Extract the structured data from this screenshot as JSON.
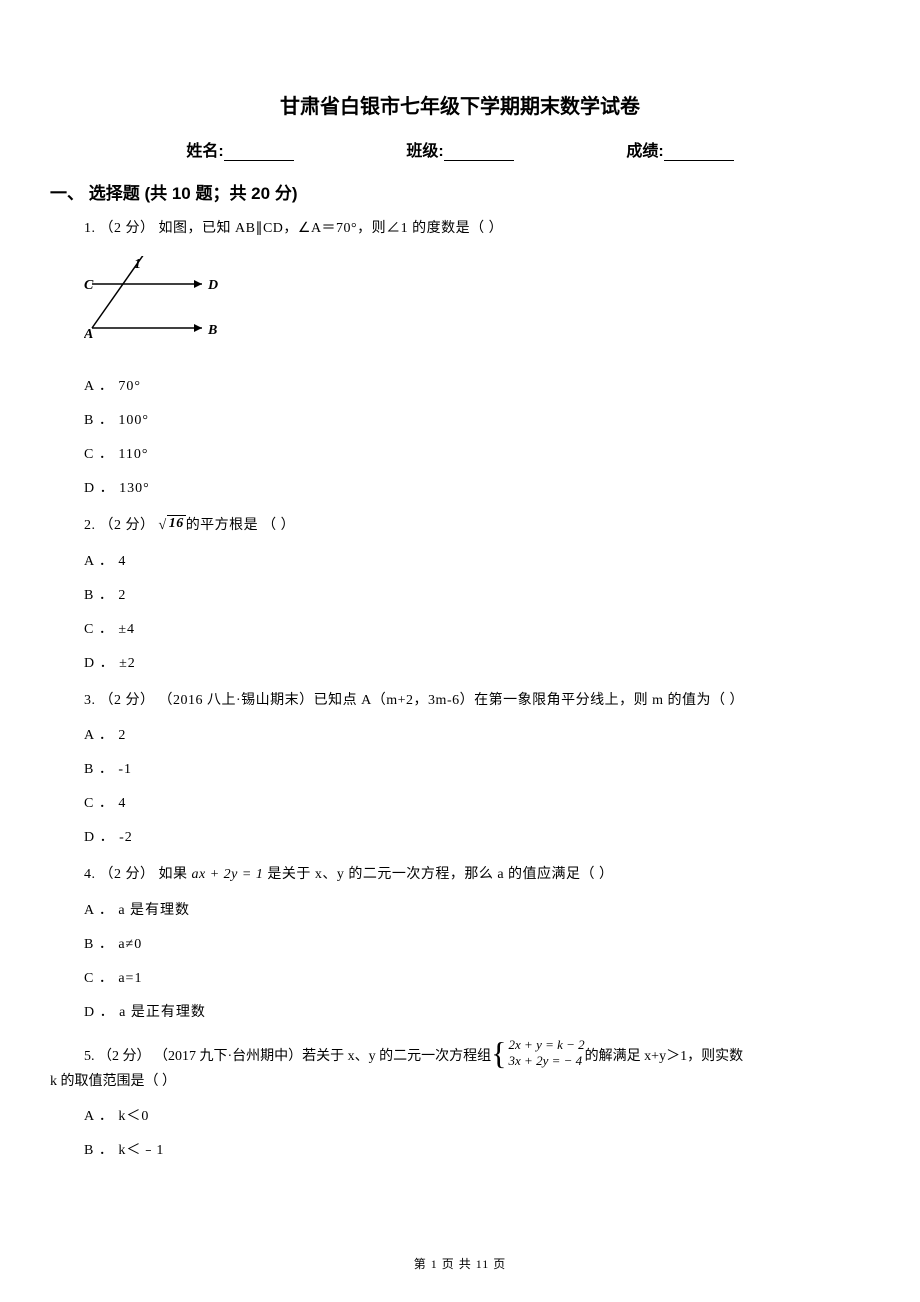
{
  "title": "甘肃省白银市七年级下学期期末数学试卷",
  "header": {
    "name_label": "姓名:",
    "class_label": "班级:",
    "score_label": "成绩:"
  },
  "section1": {
    "title": "一、 选择题 (共 10 题；共 20 分)"
  },
  "q1": {
    "stem": "1.  （2 分）  如图，已知 AB∥CD，∠A＝70°，则∠1 的度数是（    ）",
    "figure": {
      "label1": "1",
      "labelC": "C",
      "labelD": "D",
      "labelA": "A",
      "labelB": "B"
    },
    "options": {
      "A": "A ． 70°",
      "B": "B ． 100°",
      "C": "C ． 110°",
      "D": "D ． 130°"
    }
  },
  "q2": {
    "stem_pre": "2.  （2 分）  ",
    "radicand": "16",
    "stem_post": "的平方根是    （    ）",
    "options": {
      "A": "A ． 4",
      "B": "B ． 2",
      "C": "C ． ±4",
      "D": "D ． ±2"
    }
  },
  "q3": {
    "stem": "3.  （2 分） （2016 八上·锡山期末）已知点 A（m+2，3m-6）在第一象限角平分线上，则 m 的值为（    ）",
    "options": {
      "A": "A ． 2",
      "B": "B ． -1",
      "C": "C ． 4",
      "D": "D ． -2"
    }
  },
  "q4": {
    "stem_pre": "4.  （2 分）  如果 ",
    "formula": "ax + 2y = 1",
    "stem_post": " 是关于 x、y 的二元一次方程，那么 a 的值应满足（    ）",
    "options": {
      "A": "A ． a 是有理数",
      "B": "B ． a≠0",
      "C": "C ． a=1",
      "D": "D ． a 是正有理数"
    }
  },
  "q5": {
    "stem_pre": "5.  （2 分） （2017 九下·台州期中）若关于 x、y 的二元一次方程组 ",
    "eq1": "2x + y = k − 2",
    "eq2": "3x + 2y = − 4",
    "stem_post": " 的解满足 x+y＞1，则实数",
    "line2": "k 的取值范围是（    ）",
    "options": {
      "A": "A ． k＜0",
      "B": "B ． k＜﹣1"
    }
  },
  "footer": {
    "page_current": "1",
    "page_total": "11",
    "prefix": "第 ",
    "middle": " 页 共 ",
    "suffix": " 页"
  }
}
